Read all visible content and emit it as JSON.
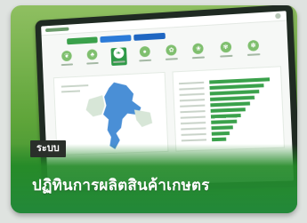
{
  "card": {
    "tag_label": "ระบบ",
    "title": "ปฏิทินการผลิตสินค้าเกษตร"
  },
  "dashboard": {
    "tabs": [
      "green",
      "blue1",
      "blue2"
    ],
    "icon_count": 8,
    "active_icon_index": 2,
    "chart_bar_fractions": [
      1.0,
      0.9,
      0.82,
      0.74,
      0.66,
      0.58,
      0.5,
      0.43,
      0.36,
      0.3,
      0.24
    ]
  },
  "colors": {
    "card_green": "#5fa53a",
    "caption_green": "#23883a",
    "tag_bg": "#2a2f2a",
    "chart_bar": "#3aa14b"
  }
}
